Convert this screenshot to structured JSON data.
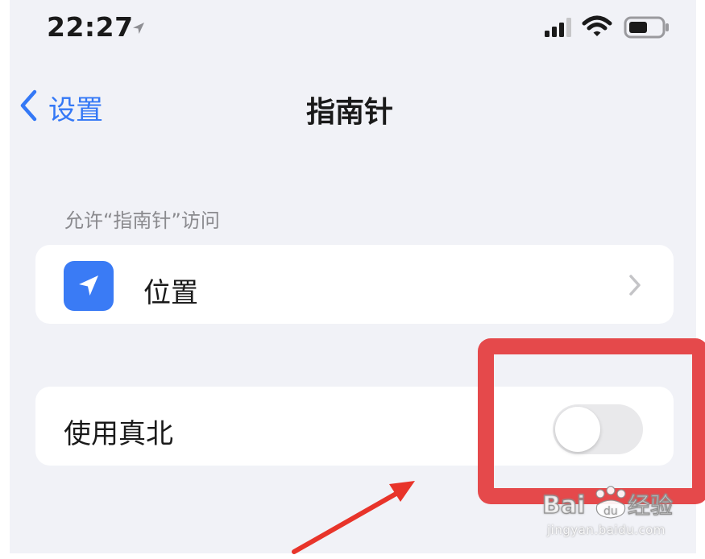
{
  "status_bar": {
    "time": "22:27",
    "icons": [
      "location-arrow-icon",
      "cellular-signal-icon",
      "wifi-icon",
      "battery-icon"
    ]
  },
  "nav": {
    "back_label": "设置",
    "title": "指南针"
  },
  "section": {
    "header": "允许“指南针”访问"
  },
  "rows": {
    "location": {
      "label": "位置",
      "icon": "location-arrow-icon"
    },
    "true_north": {
      "label": "使用真北",
      "toggle_on": false
    }
  },
  "colors": {
    "accent": "#3478f6",
    "app_icon_bg": "#3a7bf5",
    "highlight": "#e5494b",
    "background": "#f1f2f7"
  },
  "watermark": {
    "logo_text": "Baidu经验",
    "url": "jingyan.baidu.com"
  }
}
